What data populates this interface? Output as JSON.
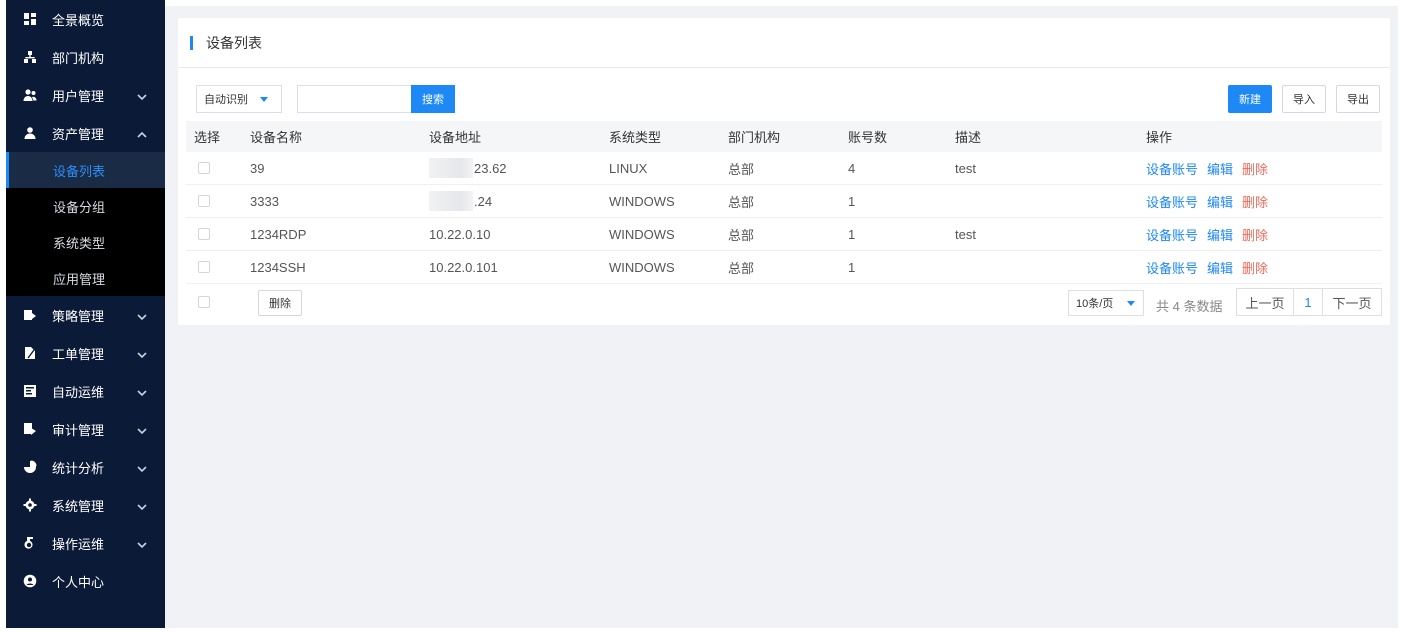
{
  "sidebar": {
    "items": [
      {
        "label": "全景概览",
        "icon": "dashboard-icon",
        "chevron": ""
      },
      {
        "label": "部门机构",
        "icon": "org-tree-icon",
        "chevron": ""
      },
      {
        "label": "用户管理",
        "icon": "users-icon",
        "chevron": "down"
      },
      {
        "label": "资产管理",
        "icon": "assets-icon",
        "chevron": "up"
      },
      {
        "label": "策略管理",
        "icon": "policy-icon",
        "chevron": "down"
      },
      {
        "label": "工单管理",
        "icon": "ticket-icon",
        "chevron": "down"
      },
      {
        "label": "自动运维",
        "icon": "automation-icon",
        "chevron": "down"
      },
      {
        "label": "审计管理",
        "icon": "audit-icon",
        "chevron": "down"
      },
      {
        "label": "统计分析",
        "icon": "pie-chart-icon",
        "chevron": "down"
      },
      {
        "label": "系统管理",
        "icon": "settings-icon",
        "chevron": "down"
      },
      {
        "label": "操作运维",
        "icon": "operations-icon",
        "chevron": "down"
      },
      {
        "label": "个人中心",
        "icon": "user-circle-icon",
        "chevron": ""
      }
    ],
    "sub_items": [
      "设备列表",
      "设备分组",
      "系统类型",
      "应用管理"
    ],
    "active_sub": "设备列表"
  },
  "card": {
    "title": "设备列表"
  },
  "toolbar": {
    "select_value": "自动识别",
    "search_value": "",
    "search_label": "搜索",
    "new_label": "新建",
    "import_label": "导入",
    "export_label": "导出"
  },
  "table": {
    "headers": [
      "选择",
      "设备名称",
      "设备地址",
      "系统类型",
      "部门机构",
      "账号数",
      "描述",
      "操作"
    ],
    "rows": [
      {
        "name": "39",
        "address": "23.62",
        "address_blurred": true,
        "os": "LINUX",
        "dept": "总部",
        "accounts": "4",
        "desc": "test"
      },
      {
        "name": "3333",
        "address": ".24",
        "address_blurred": true,
        "os": "WINDOWS",
        "dept": "总部",
        "accounts": "1",
        "desc": ""
      },
      {
        "name": "1234RDP",
        "address": "10.22.0.10",
        "address_blurred": false,
        "os": "WINDOWS",
        "dept": "总部",
        "accounts": "1",
        "desc": "test"
      },
      {
        "name": "1234SSH",
        "address": "10.22.0.101",
        "address_blurred": false,
        "os": "WINDOWS",
        "dept": "总部",
        "accounts": "1",
        "desc": ""
      }
    ],
    "actions": {
      "accounts": "设备账号",
      "edit": "编辑",
      "delete": "删除"
    }
  },
  "footer": {
    "bulk_delete_label": "删除",
    "page_size": "10条/页",
    "total_text": "共 4 条数据",
    "prev_label": "上一页",
    "current_page": "1",
    "next_label": "下一页"
  },
  "colors": {
    "sidebar_bg": "#0b1a36",
    "accent": "#1e88f5",
    "danger": "#f06a5a",
    "content_bg": "#f0f2f5"
  }
}
